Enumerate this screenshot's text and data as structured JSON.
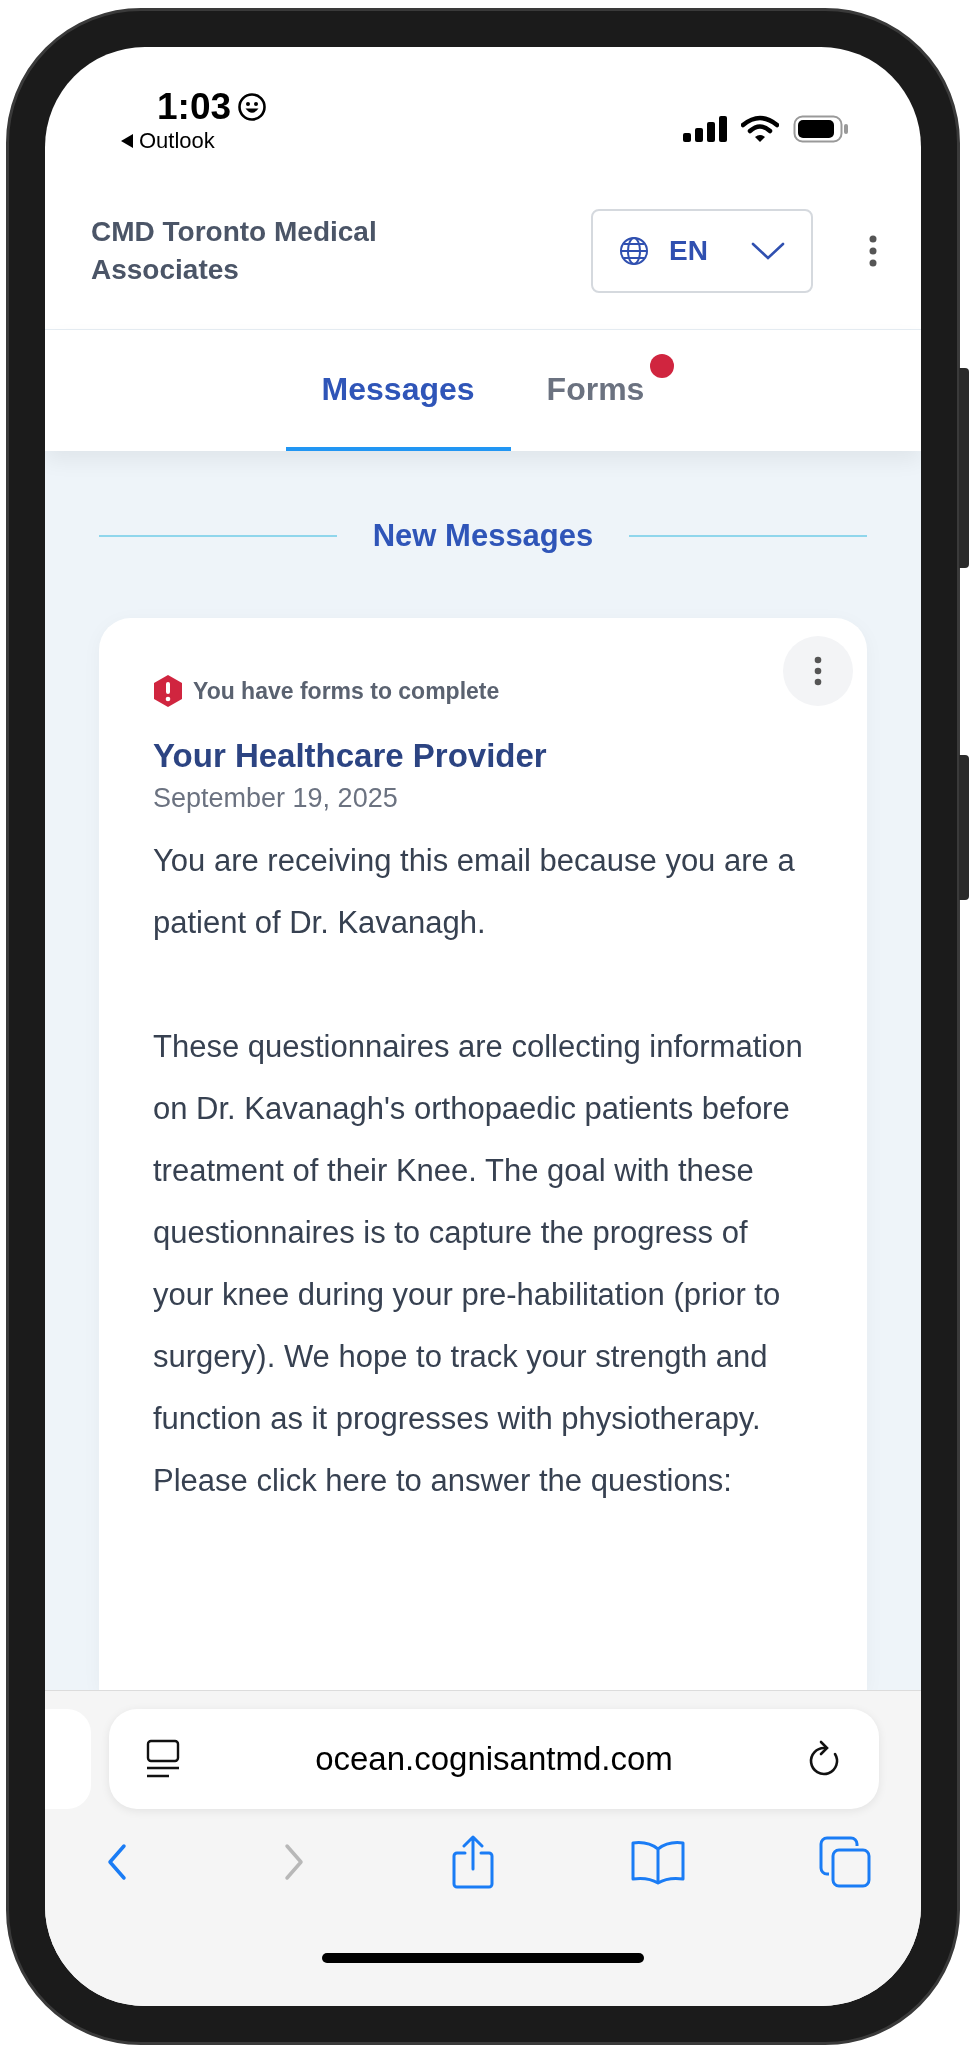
{
  "status_bar": {
    "time": "1:03",
    "back_app": "Outlook"
  },
  "header": {
    "title": "CMD Toronto Medical Associates",
    "language": "EN"
  },
  "tabs": [
    {
      "label": "Messages",
      "selected": true,
      "badge": false
    },
    {
      "label": "Forms",
      "selected": false,
      "badge": true
    }
  ],
  "section_title": "New Messages",
  "message": {
    "alert": "You have forms to complete",
    "sender": "Your Healthcare Provider",
    "date": "September 19, 2025",
    "paragraphs": [
      "You are receiving this email because you are a patient of Dr. Kavanagh.",
      "These questionnaires are collecting information on Dr. Kavanagh's orthopaedic patients before treatment of their Knee. The goal with these questionnaires is to capture the progress of your knee during your pre-habilitation (prior to surgery). We hope to track your strength and function as it progresses with physiotherapy. Please click here to answer the questions:"
    ]
  },
  "browser": {
    "url": "ocean.cognisantmd.com",
    "nav": [
      {
        "kind": "back",
        "disabled": false
      },
      {
        "kind": "forward",
        "disabled": true
      }
    ]
  }
}
